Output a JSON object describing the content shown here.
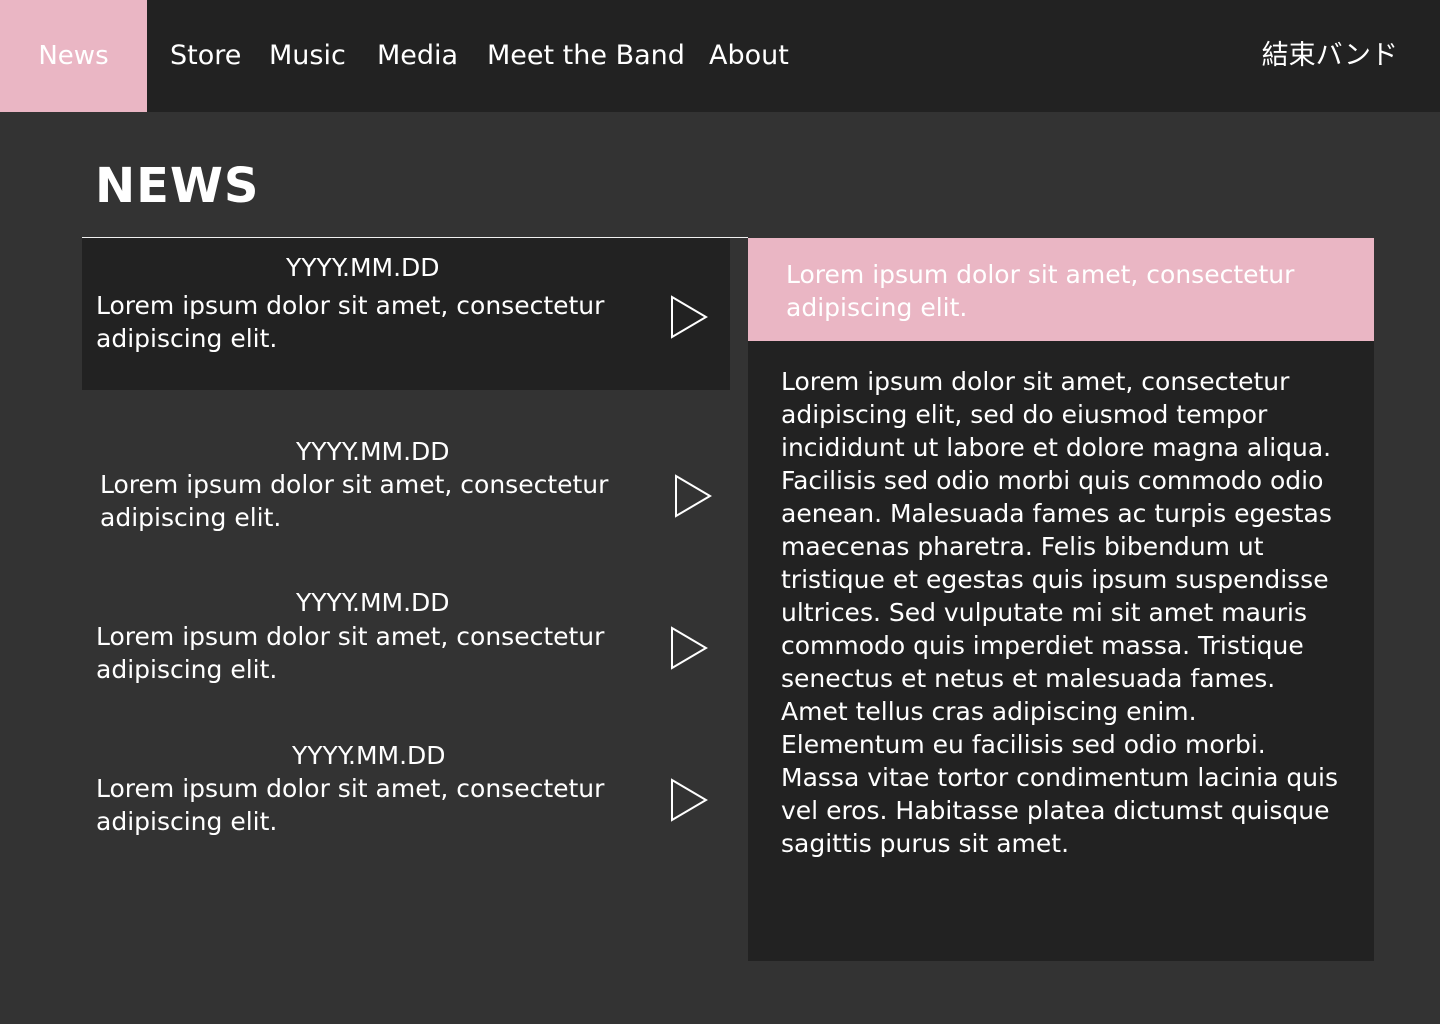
{
  "nav": {
    "items": [
      {
        "label": "News",
        "active": true
      },
      {
        "label": "Store"
      },
      {
        "label": "Music"
      },
      {
        "label": "Media"
      },
      {
        "label": "Meet the Band"
      },
      {
        "label": "About"
      }
    ],
    "brand": "結束バンド"
  },
  "page": {
    "title": "NEWS"
  },
  "news": [
    {
      "date": "YYYY.MM.DD",
      "excerpt": "Lorem ipsum dolor sit amet, consectetur adipiscing elit.",
      "selected": true,
      "arrow_icon": "play-arrow-icon"
    },
    {
      "date": "YYYY.MM.DD",
      "excerpt": "Lorem ipsum dolor sit amet, consectetur adipiscing elit.",
      "arrow_icon": "play-arrow-icon"
    },
    {
      "date": "YYYY.MM.DD",
      "excerpt": "Lorem ipsum dolor sit amet, consectetur adipiscing elit.",
      "arrow_icon": "play-arrow-icon"
    },
    {
      "date": "YYYY.MM.DD",
      "excerpt": "Lorem ipsum dolor sit amet, consectetur adipiscing elit.",
      "arrow_icon": "play-arrow-icon"
    }
  ],
  "detail": {
    "title": "Lorem ipsum dolor sit amet, consectetur adipiscing elit.",
    "body": "Lorem ipsum dolor sit amet, consectetur adipiscing elit, sed do eiusmod tempor incididunt ut labore et dolore magna aliqua. Facilisis sed odio morbi quis commodo odio aenean. Malesuada fames ac turpis egestas maecenas pharetra. Felis bibendum ut tristique et egestas quis ipsum suspendisse ultrices. Sed vulputate mi sit amet mauris commodo quis imperdiet massa. Tristique senectus et netus et malesuada fames. Amet tellus cras adipiscing enim. Elementum eu facilisis sed odio morbi. Massa vitae tortor condimentum lacinia quis vel eros. Habitasse platea dictumst quisque sagittis purus sit amet."
  },
  "colors": {
    "accent_pink": "#eab6c4",
    "background": "#333333",
    "panel": "#222222",
    "text": "#ffffff"
  }
}
